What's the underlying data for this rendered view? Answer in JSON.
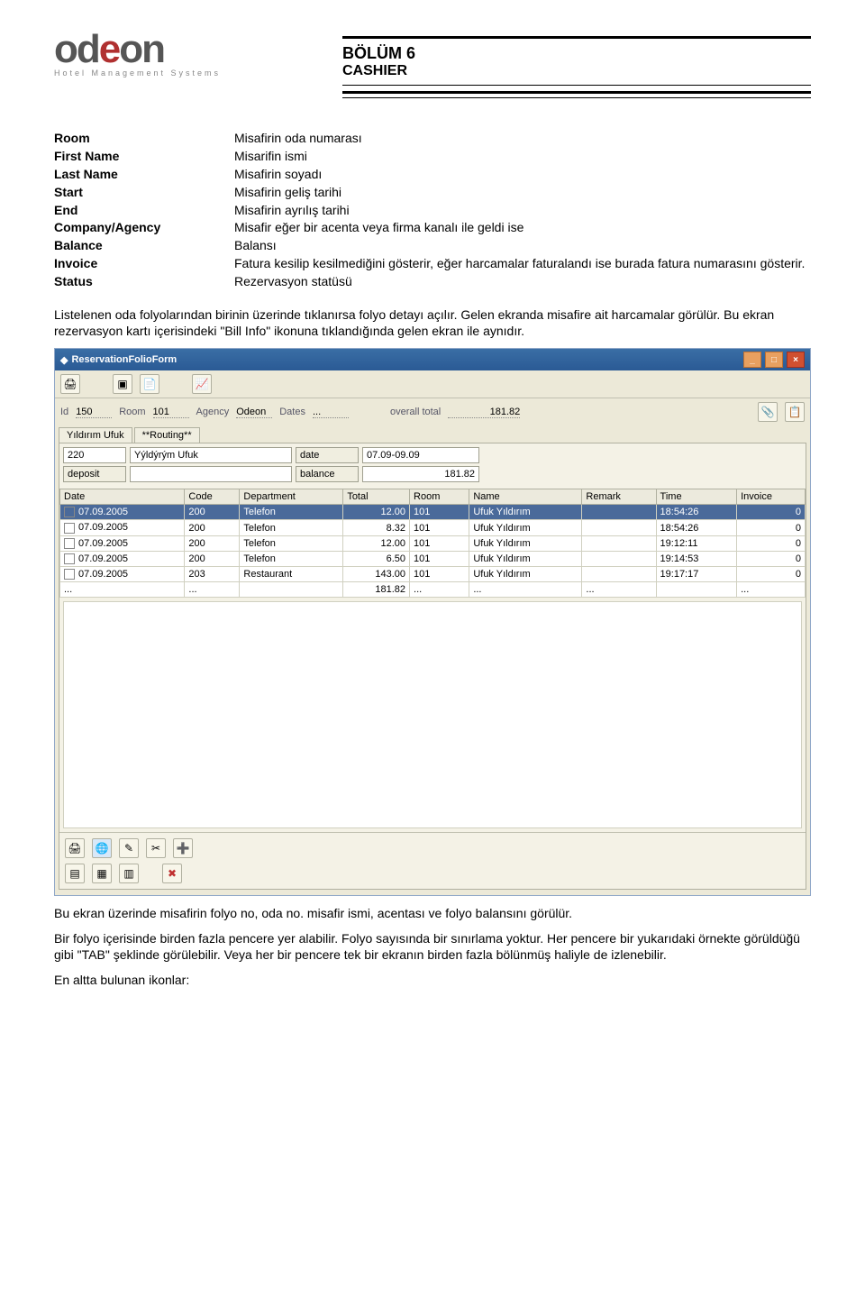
{
  "header": {
    "title_line1": "BÖLÜM 6",
    "title_line2": "CASHIER",
    "logo_text": "odeon",
    "logo_tag": "Hotel Management Systems"
  },
  "definitions": [
    {
      "k": "Room",
      "v": "Misafirin oda numarası"
    },
    {
      "k": "First Name",
      "v": "Misarifin ismi"
    },
    {
      "k": "Last Name",
      "v": "Misafirin soyadı"
    },
    {
      "k": "Start",
      "v": "Misafirin geliş tarihi"
    },
    {
      "k": "End",
      "v": "Misafirin ayrılış tarihi"
    },
    {
      "k": "Company/Agency",
      "v": "Misafir eğer bir acenta veya firma kanalı ile geldi ise"
    },
    {
      "k": "Balance",
      "v": "Balansı"
    },
    {
      "k": "Invoice",
      "v": "Fatura kesilip kesilmediğini gösterir, eğer harcamalar faturalandı ise burada fatura numarasını gösterir."
    },
    {
      "k": "Status",
      "v": "Rezervasyon statüsü"
    }
  ],
  "para1": "Listelenen oda folyolarından birinin üzerinde tıklanırsa folyo detayı açılır. Gelen ekranda misafire ait harcamalar görülür. Bu ekran rezervasyon kartı içerisindeki \"Bill Info\" ikonuna tıklandığında gelen ekran ile aynıdır.",
  "screenshot": {
    "title": "ReservationFolioForm",
    "info": {
      "id_lbl": "Id",
      "id": "150",
      "room_lbl": "Room",
      "room": "101",
      "agency_lbl": "Agency",
      "agency": "Odeon",
      "dates_lbl": "Dates",
      "dates": "...",
      "total_lbl": "overall total",
      "total": "181.82"
    },
    "tabs": [
      "Yıldırım Ufuk",
      "**Routing**"
    ],
    "fields": {
      "code": "220",
      "name": "Yýldýrým Ufuk",
      "date_lbl": "date",
      "date": "07.09-09.09",
      "deposit_lbl": "deposit",
      "deposit": "",
      "balance_lbl": "balance",
      "balance": "181.82"
    },
    "grid": {
      "cols": [
        "Date",
        "Code",
        "Department",
        "Total",
        "Room",
        "Name",
        "Remark",
        "Time",
        "Invoice"
      ],
      "rows": [
        {
          "sel": true,
          "date": "07.09.2005",
          "code": "200",
          "dept": "Telefon",
          "total": "12.00",
          "room": "101",
          "name": "Ufuk Yıldırım",
          "remark": "",
          "time": "18:54:26",
          "inv": "0"
        },
        {
          "date": "07.09.2005",
          "code": "200",
          "dept": "Telefon",
          "total": "8.32",
          "room": "101",
          "name": "Ufuk Yıldırım",
          "remark": "",
          "time": "18:54:26",
          "inv": "0"
        },
        {
          "date": "07.09.2005",
          "code": "200",
          "dept": "Telefon",
          "total": "12.00",
          "room": "101",
          "name": "Ufuk Yıldırım",
          "remark": "",
          "time": "19:12:11",
          "inv": "0"
        },
        {
          "date": "07.09.2005",
          "code": "200",
          "dept": "Telefon",
          "total": "6.50",
          "room": "101",
          "name": "Ufuk Yıldırım",
          "remark": "",
          "time": "19:14:53",
          "inv": "0"
        },
        {
          "date": "07.09.2005",
          "code": "203",
          "dept": "Restaurant",
          "total": "143.00",
          "room": "101",
          "name": "Ufuk Yıldırım",
          "remark": "",
          "time": "19:17:17",
          "inv": "0"
        }
      ],
      "footer": {
        "date": "...",
        "code": "...",
        "dept": "",
        "total": "181.82",
        "room": "...",
        "name": "...",
        "remark": "...",
        "time": "",
        "inv": "..."
      }
    }
  },
  "para2": "Bu ekran üzerinde misafirin folyo no, oda no. misafir ismi, acentası ve folyo balansını görülür.",
  "para3": "Bir folyo içerisinde birden fazla pencere yer alabilir. Folyo sayısında bir sınırlama yoktur. Her pencere bir yukarıdaki örnekte görüldüğü gibi \"TAB\" şeklinde görülebilir. Veya her bir pencere  tek bir ekranın birden fazla bölünmüş haliyle de izlenebilir.",
  "para4": "En altta bulunan ikonlar:"
}
